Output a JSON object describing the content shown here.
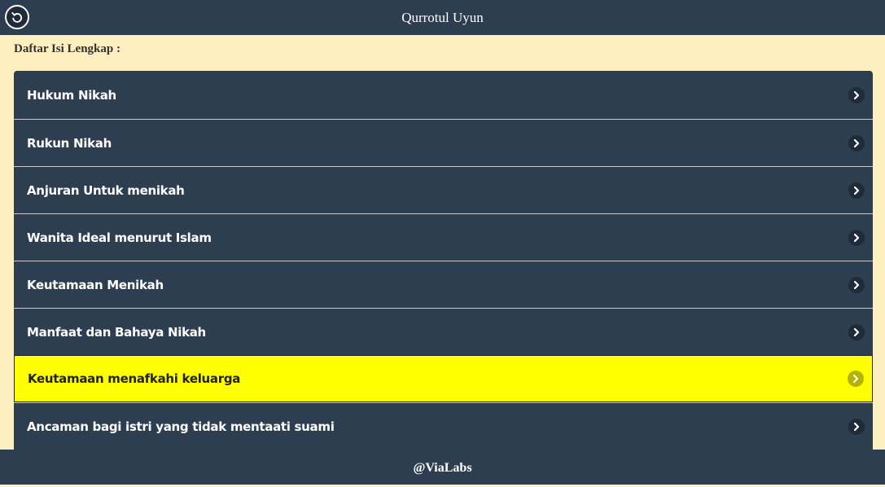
{
  "header": {
    "title": "Qurrotul Uyun",
    "back_icon": "back-icon"
  },
  "section": {
    "title": "Daftar Isi Lengkap :"
  },
  "menu": {
    "items": [
      {
        "label": "Hukum Nikah"
      },
      {
        "label": "Rukun Nikah"
      },
      {
        "label": "Anjuran Untuk menikah"
      },
      {
        "label": "Wanita Ideal menurut Islam"
      },
      {
        "label": "Keutamaan Menikah"
      },
      {
        "label": "Manfaat dan Bahaya Nikah"
      },
      {
        "label": "Keutamaan menafkahi keluarga"
      },
      {
        "label": "Ancaman bagi istri yang tidak mentaati suami"
      }
    ],
    "active_index": 6,
    "active_color": "#ffff00",
    "item_color": "#2e3e51"
  },
  "footer": {
    "text": "@ViaLabs"
  },
  "colors": {
    "background": "#fdefc0",
    "bar": "#2e3e51"
  }
}
